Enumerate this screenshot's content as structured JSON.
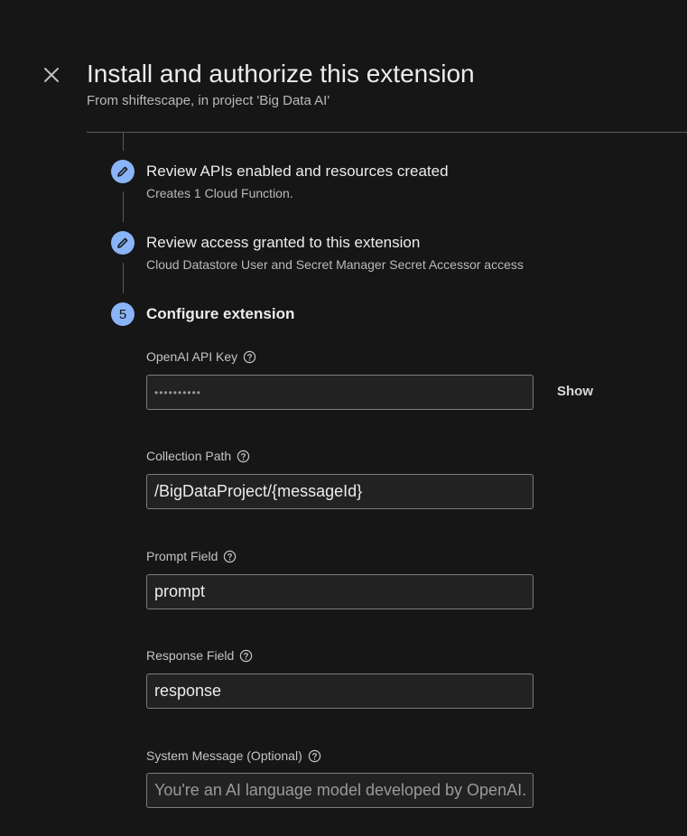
{
  "header": {
    "title": "Install and authorize this extension",
    "subtitle": "From shiftescape, in project 'Big Data AI'"
  },
  "steps": [
    {
      "title": "Review APIs enabled and resources created",
      "description": "Creates 1 Cloud Function.",
      "icon": "pencil-icon"
    },
    {
      "title": "Review access granted to this extension",
      "description": "Cloud Datastore User and Secret Manager Secret Accessor access",
      "icon": "pencil-icon"
    },
    {
      "number": "5",
      "title": "Configure extension"
    }
  ],
  "fields": {
    "openai_key": {
      "label": "OpenAI API Key",
      "value": "••••••••••",
      "show_label": "Show"
    },
    "collection_path": {
      "label": "Collection Path",
      "value": "/BigDataProject/{messageId}"
    },
    "prompt_field": {
      "label": "Prompt Field",
      "value": "prompt"
    },
    "response_field": {
      "label": "Response Field",
      "value": "response"
    },
    "system_message": {
      "label": "System Message (Optional)",
      "placeholder": "You're an AI language model developed by OpenAI. P"
    }
  },
  "colors": {
    "background": "#161616",
    "accent": "#8ab4f8",
    "input_bg": "#222222"
  }
}
